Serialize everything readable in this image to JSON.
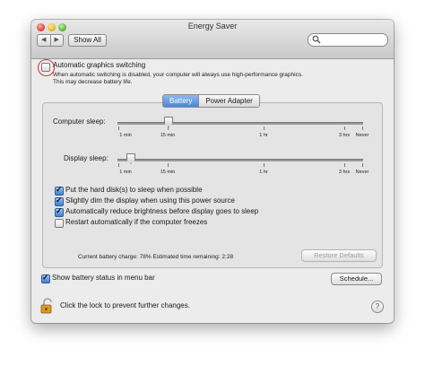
{
  "window": {
    "title": "Energy Saver"
  },
  "toolbar": {
    "back_label": "◀",
    "forward_label": "▶",
    "show_all_label": "Show All",
    "search_placeholder": ""
  },
  "graphics": {
    "label": "Automatic graphics switching",
    "checked": false,
    "note_line1": "When automatic switching is disabled, your computer will always use high-performance graphics.",
    "note_line2": "This may decrease battery life."
  },
  "tabs": [
    {
      "label": "Battery",
      "selected": true
    },
    {
      "label": "Power Adapter",
      "selected": false
    }
  ],
  "sliders": {
    "computer_sleep": {
      "label": "Computer sleep:",
      "value": "15 min"
    },
    "display_sleep": {
      "label": "Display sleep:",
      "value": "2 min"
    },
    "tick_labels": [
      "1 min",
      "15 min",
      "1 hr",
      "3 hrs",
      "Never"
    ]
  },
  "options": [
    {
      "label": "Put the hard disk(s) to sleep when possible",
      "checked": true
    },
    {
      "label": "Slightly dim the display when using this power source",
      "checked": true
    },
    {
      "label": "Automatically reduce brightness before display goes to sleep",
      "checked": true
    },
    {
      "label": "Restart automatically if the computer freezes",
      "checked": false
    }
  ],
  "status": {
    "battery_text": "Current battery charge: 78%  Estimated time remaining: 2:28"
  },
  "buttons": {
    "restore_defaults": "Restore Defaults",
    "schedule": "Schedule..."
  },
  "menu_bar_option": {
    "label": "Show battery status in menu bar",
    "checked": true
  },
  "lock": {
    "label": "Click the lock to prevent further changes."
  },
  "help": {
    "label": "?"
  },
  "colors": {
    "highlight_circle": "#d8323a",
    "accent_blue": "#4a87d6"
  }
}
